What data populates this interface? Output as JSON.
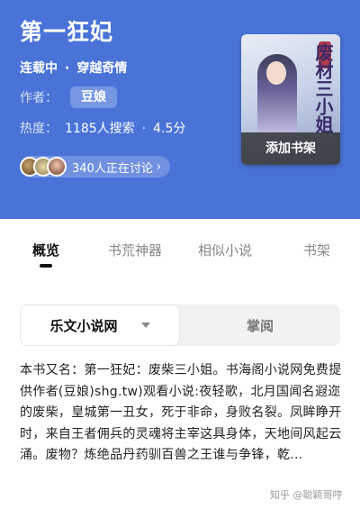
{
  "book": {
    "title": "第一狂妃",
    "status": "连载中",
    "genre": "穿越奇情",
    "author_label": "作者：",
    "author": "豆娘",
    "heat_label": "热度：",
    "searches": "1185人搜索",
    "score": "4.5分",
    "discussing": "340人正在讨论",
    "cover_title": "废材三小姐",
    "add_shelf": "添加书架"
  },
  "tabs": [
    {
      "label": "概览",
      "active": true
    },
    {
      "label": "书荒神器",
      "active": false
    },
    {
      "label": "相似小说",
      "active": false
    },
    {
      "label": "书架",
      "active": false
    }
  ],
  "source": {
    "selected": "乐文小说网",
    "other": "掌阅"
  },
  "description": "本书又名：第一狂妃：废柴三小姐。书海阁小说网免费提供作者(豆娘)shg.tw)观看小说:夜轻歌，北月国闻名遐迩的废柴，皇城第一丑女，死于非命，身败名裂。凤眸睁开时，来自王者佣兵的灵魂将主宰这具身体，天地间风起云涌。废物？炼绝品丹药驯百兽之王谁与争锋，乾...",
  "watermark": "知乎 @聪颖哥哼",
  "colors": {
    "header_bg": "#4a73d8",
    "active_tab": "#111111",
    "inactive_tab": "#888888"
  },
  "icons": {
    "discuss_chevron": "chevron-right-icon",
    "source_dropdown": "caret-down-icon"
  }
}
